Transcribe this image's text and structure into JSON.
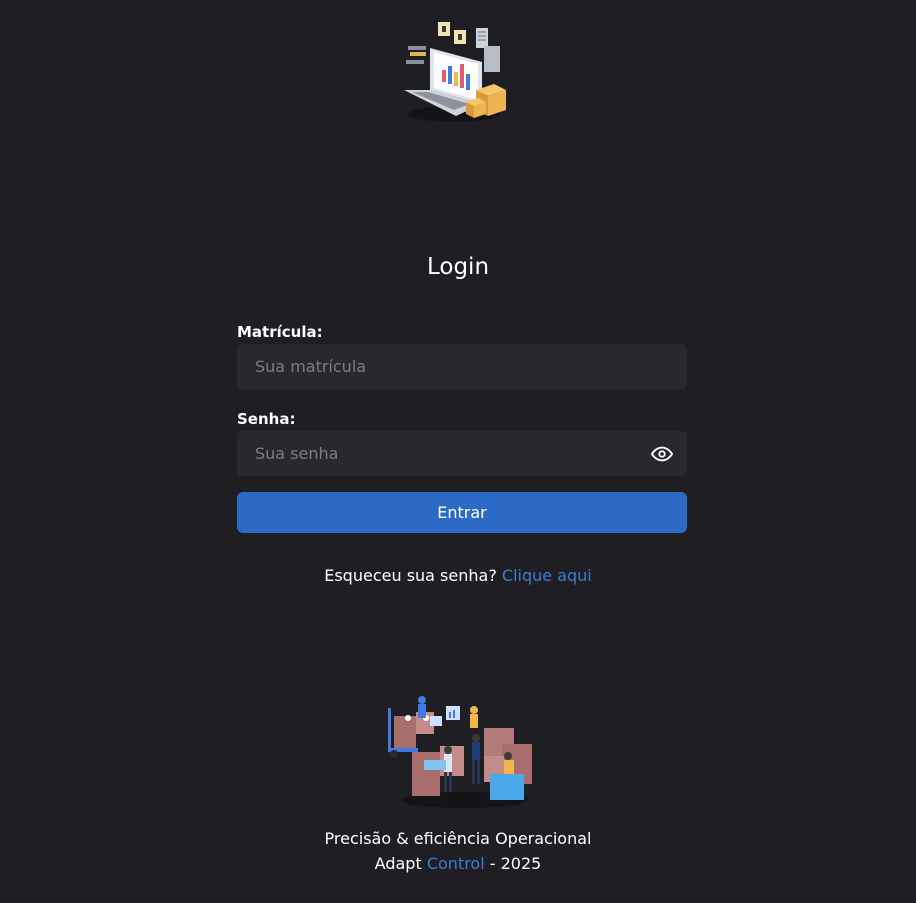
{
  "login": {
    "title": "Login"
  },
  "form": {
    "matricula_label": "Matrícula:",
    "matricula_placeholder": "Sua matrícula",
    "senha_label": "Senha:",
    "senha_placeholder": "Sua senha",
    "submit_label": "Entrar"
  },
  "forgot": {
    "text": "Esqueceu sua senha?",
    "link": "Clique aqui"
  },
  "footer": {
    "tagline": "Precisão & eficiência Operacional",
    "brand_prefix": "Adapt",
    "brand_accent": "Control",
    "year_suffix": "- 2025"
  },
  "icons": {
    "password_toggle": "eye-icon",
    "top_image": "laptop-analytics-illustration",
    "bottom_image": "warehouse-team-illustration"
  },
  "colors": {
    "background": "#1f1e22",
    "input_background": "#29282d",
    "primary": "#2c6ac6",
    "accent_text": "#3d7bd6"
  }
}
